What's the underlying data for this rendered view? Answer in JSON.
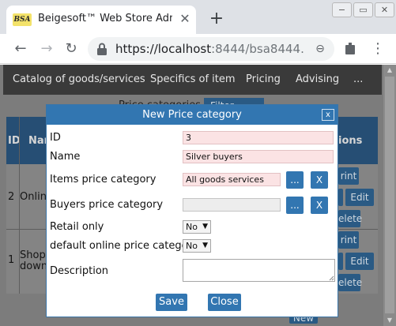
{
  "browser": {
    "favicon_text": "BSA",
    "tab_title": "Beigesoft™ Web Store Adm",
    "url_host": "https://localhost",
    "url_rest": ":8444/bsa8444...",
    "window_buttons": [
      "−",
      "▭",
      "✕"
    ]
  },
  "app_nav": {
    "items": [
      "Catalog of goods/services",
      "Specifics of item",
      "Pricing",
      "Advising",
      "..."
    ]
  },
  "background": {
    "heading_partial": "Price categories",
    "filter_button_partial": "Filter...",
    "id_header": "ID",
    "name_header_partial": "Nam",
    "actions_header_partial": "ions",
    "rows": [
      {
        "id": "2",
        "name_partial": "Onlin"
      },
      {
        "id": "1",
        "name_partial_line1": "Shop",
        "name_partial_line2": "downt"
      }
    ],
    "row_buttons": {
      "print_partial": "rint",
      "edit": "Edit",
      "delete_partial": "elete",
      "new_partial": "New"
    }
  },
  "modal": {
    "title": "New Price category",
    "close_label": "x",
    "fields": {
      "id_label": "ID",
      "id_value": "3",
      "name_label": "Name",
      "name_value": "Silver buyers",
      "items_price_category_label": "Items price category",
      "items_price_category_value": "All goods services",
      "buyers_price_category_label": "Buyers price category",
      "buyers_price_category_value": "",
      "retail_only_label": "Retail only",
      "retail_only_value": "No",
      "default_online_label": "default online price category",
      "default_online_value": "No",
      "description_label": "Description",
      "description_value": ""
    },
    "picker_label": "...",
    "clear_label": "X",
    "save_label": "Save",
    "close_button_label": "Close"
  },
  "colors": {
    "modal_header": "#3276b1",
    "button": "#3276b1",
    "required_field": "#fbe3e4",
    "app_nav_bg": "#3a3a3a",
    "overlay_bg": "#7c7c7c"
  }
}
